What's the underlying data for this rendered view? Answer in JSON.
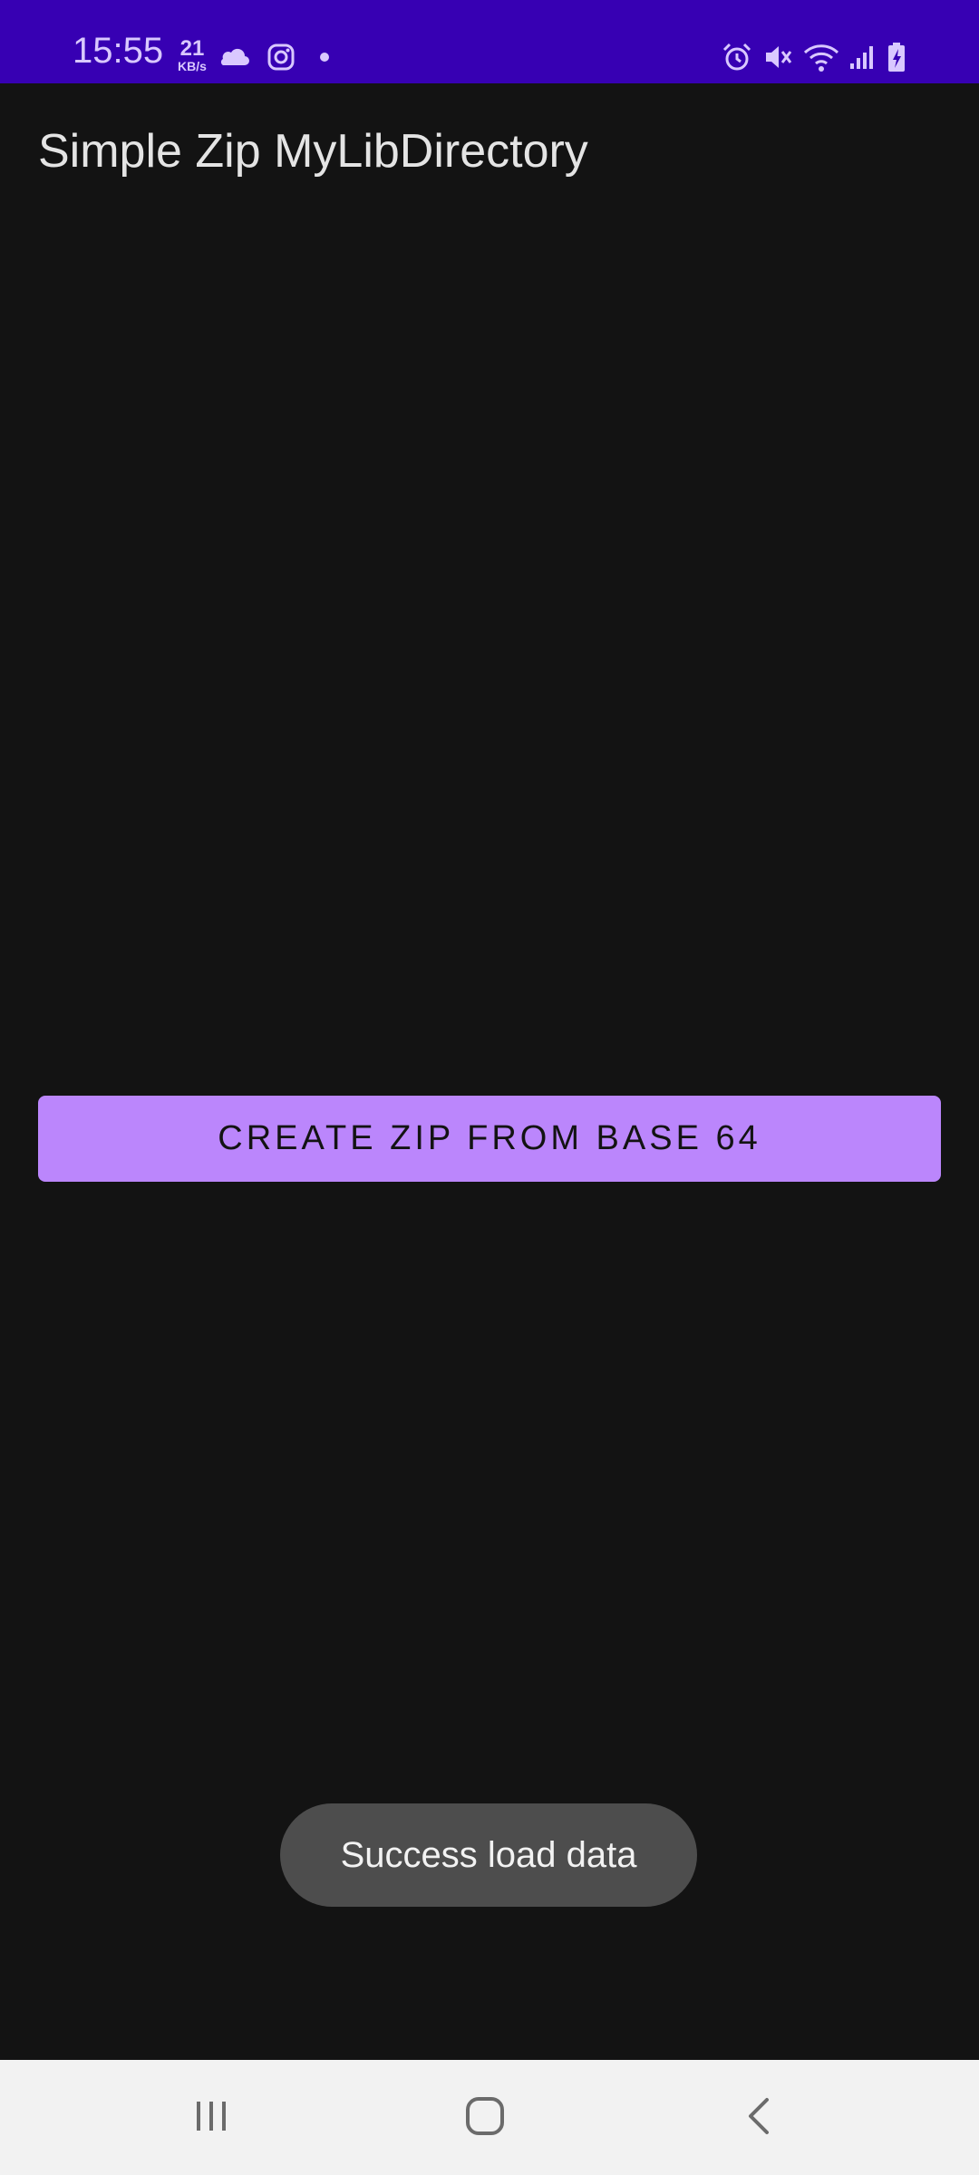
{
  "status_bar": {
    "time": "15:55",
    "speed_value": "21",
    "speed_unit": "KB/s",
    "left_icons": [
      "cloud-icon",
      "instagram-icon",
      "notification-dot-icon"
    ],
    "right_icons": [
      "alarm-icon",
      "mute-icon",
      "wifi-icon",
      "signal-icon",
      "battery-charging-icon"
    ],
    "background_color": "#3700b3",
    "icon_color": "#d9c8ff"
  },
  "app_bar": {
    "title": "Simple Zip MyLibDirectory"
  },
  "main": {
    "create_zip_button_label": "CREATE ZIP FROM BASE 64",
    "button_color": "#bb86fc",
    "background_color": "#131313"
  },
  "toast": {
    "message": "Success load data"
  },
  "nav_bar": {
    "icons": [
      "recent-apps-icon",
      "home-icon",
      "back-icon"
    ]
  }
}
